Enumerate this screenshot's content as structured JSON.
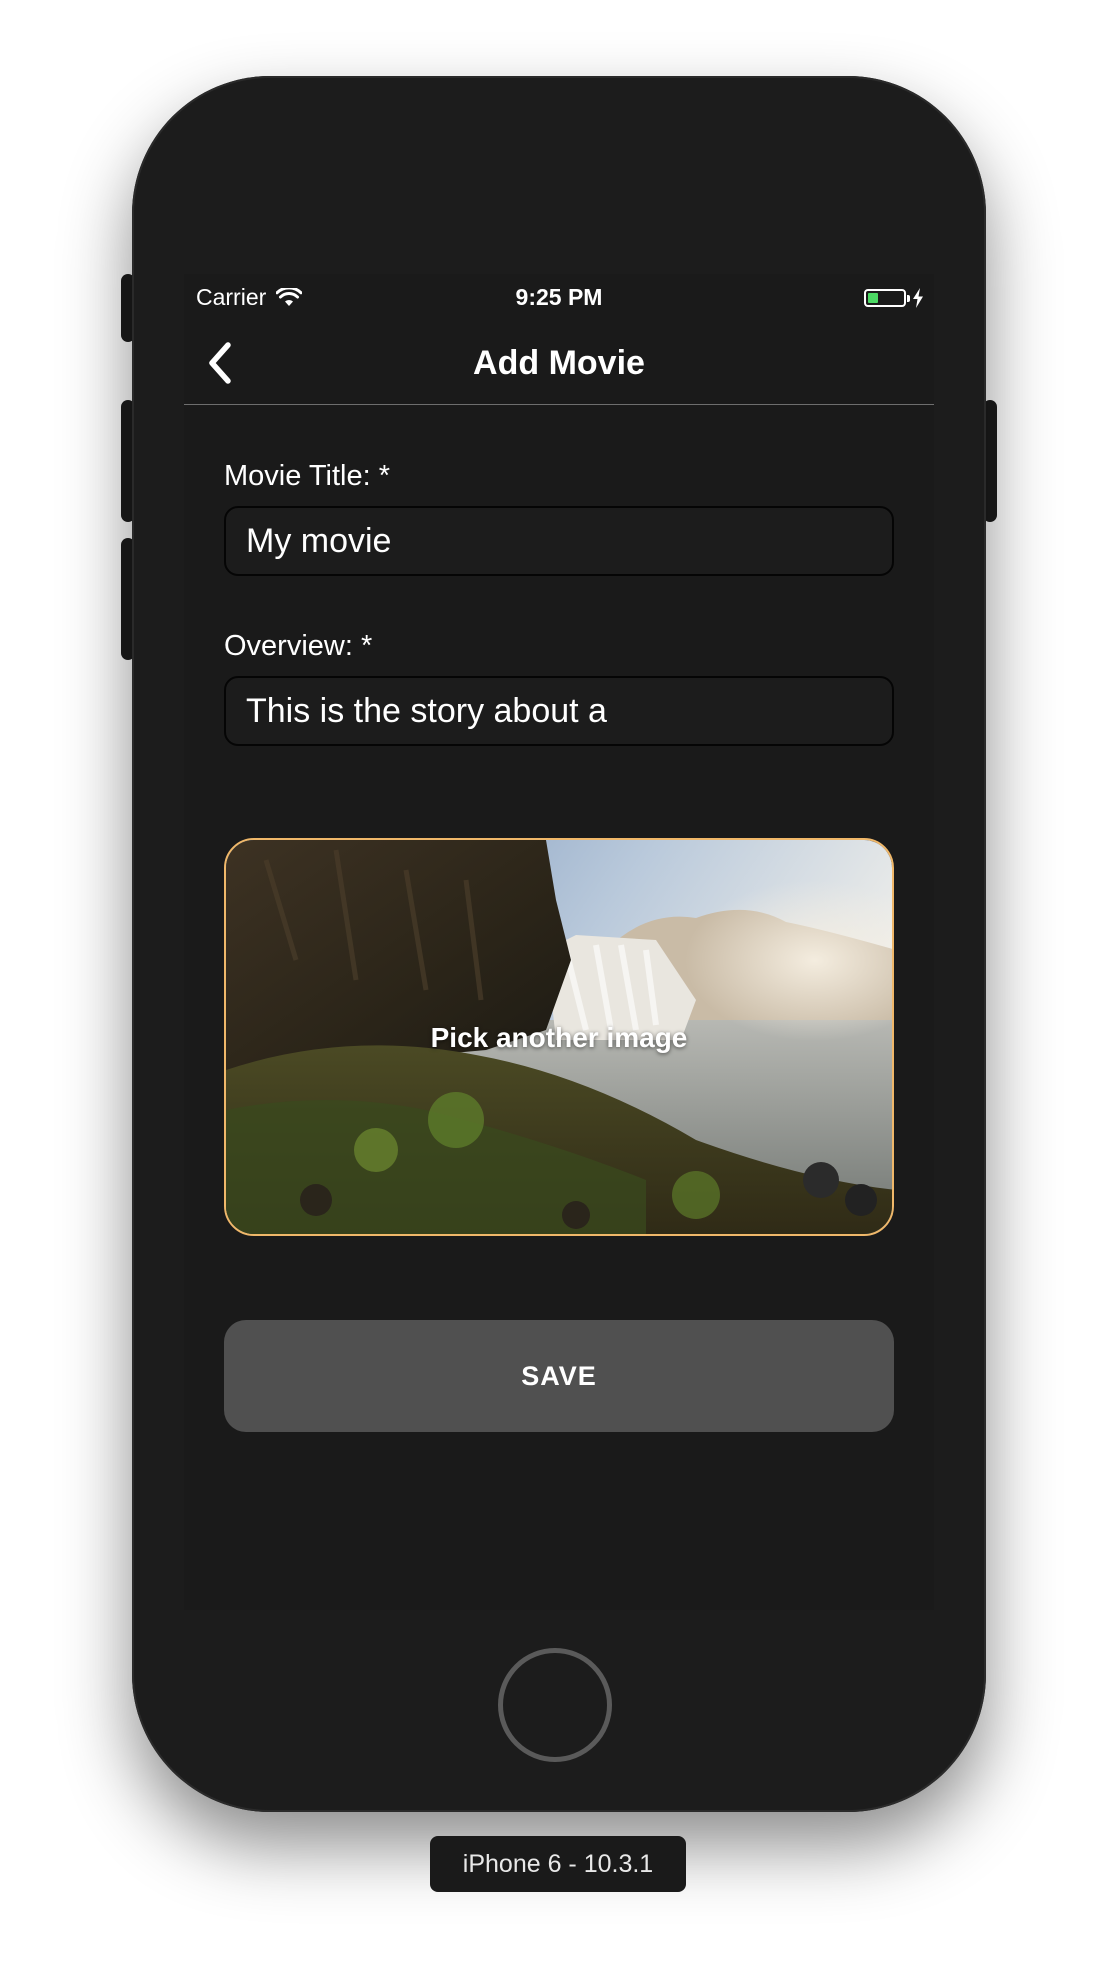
{
  "status_bar": {
    "carrier": "Carrier",
    "time": "9:25 PM",
    "battery_level": 0.3,
    "battery_color": "#4cd964"
  },
  "nav": {
    "title": "Add Movie",
    "back_icon": "chevron-left-icon"
  },
  "form": {
    "title_label": "Movie Title: *",
    "title_value": "My movie",
    "overview_label": "Overview: *",
    "overview_value": "This is the story about a",
    "image_button_label": "Pick another image",
    "image_border_color": "#f0b86a",
    "save_label": "SAVE"
  },
  "device": {
    "label": "iPhone 6 - 10.3.1"
  }
}
